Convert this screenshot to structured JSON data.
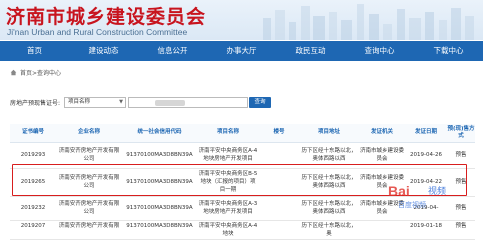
{
  "header": {
    "title": "济南市城乡建设委员会",
    "subtitle": "Ji'nan Urban and Rural Construction Committee"
  },
  "nav": {
    "items": [
      "首页",
      "建设动态",
      "信息公开",
      "办事大厅",
      "政民互动",
      "查询中心",
      "下载中心"
    ]
  },
  "breadcrumb": {
    "text": "首页>查询中心"
  },
  "search": {
    "label": "房地产预现售证号:",
    "select_value": "项目名称",
    "button_label": "查询"
  },
  "table": {
    "headers": [
      "证书编号",
      "企业名称",
      "统一社会信用代码",
      "项目名称",
      "楼号",
      "项目地址",
      "发证机关",
      "发证日期",
      "预(现)售方式"
    ],
    "rows": [
      [
        "2019293",
        "济南安齐房地产开发有限公司",
        "91370100MA3D8BN39A",
        "济南平安中央商务区A-4地块房地产开发项目",
        "",
        "历下区经十东路以北，奥体西路以西",
        "济南市城乡建设委员会",
        "2019-04-26",
        "预售"
      ],
      [
        "2019265",
        "济南安齐房地产开发有限公司",
        "91370100MA3D8BN39A",
        "济南平安中央商务区B-5地块（汇报的项目）项目一期",
        "",
        "历下区经十东路以北，奥体西路以西",
        "济南市城乡建设委员会",
        "2019-04-22",
        "预售"
      ],
      [
        "2019232",
        "济南安齐房地产开发有限公司",
        "91370100MA3D8BN39A",
        "济南平安中央商务区A-3地块房地产开发项目",
        "",
        "历下区经十东路以北，奥体西路以西",
        "济南市城乡建设委员会",
        "2019-04-",
        "预售"
      ],
      [
        "2019207",
        "济南安齐房地产开发有限",
        "91370100MA3D8BN39A",
        "济南平安中央商务区A-4地块",
        "",
        "历下区经十东路以北，奥",
        "",
        "2019-01-18",
        "预售"
      ]
    ]
  },
  "watermark": {
    "brand": "Bai",
    "video": "视频",
    "sub": "百度视频"
  }
}
